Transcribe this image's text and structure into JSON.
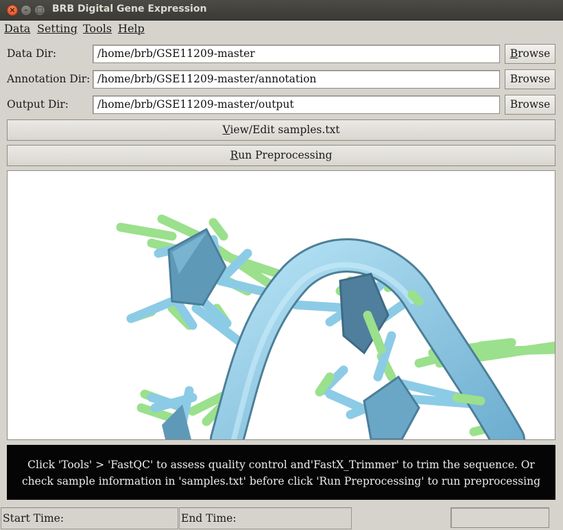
{
  "window": {
    "title": "BRB Digital Gene Expression",
    "close_glyph": "×",
    "min_glyph": "–",
    "max_glyph": "□"
  },
  "menu": [
    {
      "label": "Data"
    },
    {
      "label": "Setting"
    },
    {
      "label": "Tools"
    },
    {
      "label": "Help"
    }
  ],
  "rows": {
    "data": {
      "label": "Data Dir:",
      "value": "/home/brb/GSE11209-master"
    },
    "annotation": {
      "label": "Annotation Dir:",
      "value": "/home/brb/GSE11209-master/annotation"
    },
    "output": {
      "label": "Output Dir:",
      "value": "/home/brb/GSE11209-master/output"
    },
    "browse_first_label": "B",
    "browse_first_rest": "rowse",
    "browse_label": "Browse"
  },
  "buttons": {
    "view_edit_mnemonic": "V",
    "view_edit_rest": "iew/Edit samples.txt",
    "run_mnemonic": "R",
    "run_rest": "un Preprocessing"
  },
  "message": {
    "line1": "Click 'Tools' > 'FastQC' to assess quality control and'FastX_Trimmer' to trim the sequence. Or",
    "line2": "check sample information in 'samples.txt' before click 'Run Preprocessing' to run preprocessing"
  },
  "status": {
    "start": "Start Time:",
    "end": "End Time:"
  },
  "colors": {
    "molecule_blue": "#8ccbe6",
    "molecule_green": "#9be08c",
    "ring_fill": "#5f99b8",
    "message_bg": "#050505"
  }
}
